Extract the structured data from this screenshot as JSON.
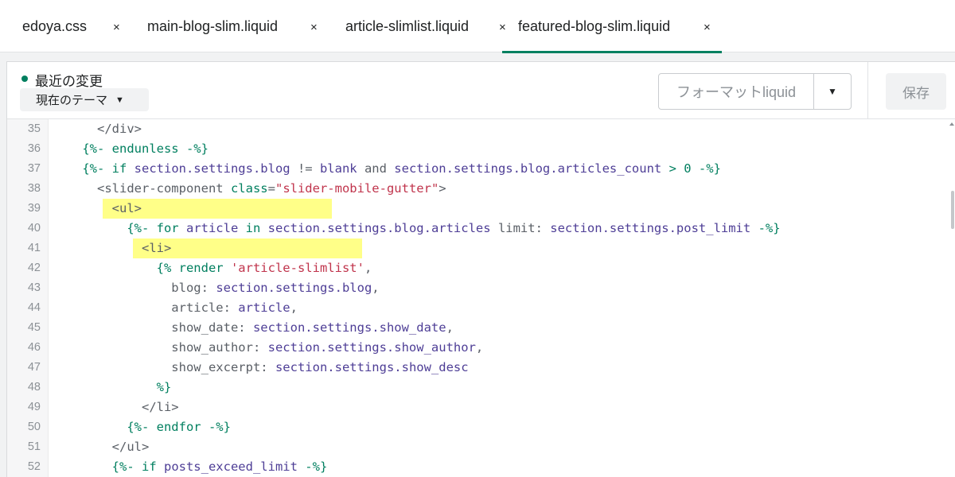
{
  "tabs": [
    {
      "label": "edoya.css",
      "close": "×",
      "active": false
    },
    {
      "label": "main-blog-slim.liquid",
      "close": "×",
      "active": false
    },
    {
      "label": "article-slimlist.liquid",
      "close": "×",
      "active": false
    },
    {
      "label": "featured-blog-slim.liquid",
      "close": "×",
      "active": true
    }
  ],
  "header": {
    "status_label": "最近の変更",
    "version_select": "現在のテーマ",
    "format_button": "フォーマットliquid",
    "save_button": "保存"
  },
  "colors": {
    "accent": "#008060",
    "keyword": "#007f5f",
    "variable": "#4e3e96",
    "string": "#c0344c",
    "tag": "#5a5f66",
    "highlight": "#ffff88"
  },
  "code": {
    "highlighted_lines": [
      39,
      41
    ],
    "lines": [
      {
        "n": "35",
        "tokens": [
          {
            "t": "      </div>",
            "c": "tag"
          }
        ]
      },
      {
        "n": "36",
        "tokens": [
          {
            "t": "    {%- endunless -%}",
            "c": "kw"
          }
        ]
      },
      {
        "n": "37",
        "tokens": [
          {
            "t": "    {%- if ",
            "c": "kw"
          },
          {
            "t": "section.settings.blog",
            "c": "var"
          },
          {
            "t": " != ",
            "c": "tag"
          },
          {
            "t": "blank",
            "c": "var"
          },
          {
            "t": " and ",
            "c": "tag"
          },
          {
            "t": "section.settings.blog.articles_count",
            "c": "var"
          },
          {
            "t": " > 0 -%}",
            "c": "kw"
          }
        ]
      },
      {
        "n": "38",
        "tokens": [
          {
            "t": "      <slider-component ",
            "c": "tag"
          },
          {
            "t": "class",
            "c": "kw"
          },
          {
            "t": "=",
            "c": "tag"
          },
          {
            "t": "\"slider-mobile-gutter\"",
            "c": "str"
          },
          {
            "t": ">",
            "c": "tag"
          }
        ]
      },
      {
        "n": "39",
        "tokens": [
          {
            "t": "        <ul>",
            "c": "tag"
          }
        ]
      },
      {
        "n": "40",
        "tokens": [
          {
            "t": "          {%- for ",
            "c": "kw"
          },
          {
            "t": "article",
            "c": "var"
          },
          {
            "t": " in ",
            "c": "kw"
          },
          {
            "t": "section.settings.blog.articles",
            "c": "var"
          },
          {
            "t": " limit: ",
            "c": "tag"
          },
          {
            "t": "section.settings.post_limit",
            "c": "var"
          },
          {
            "t": " -%}",
            "c": "kw"
          }
        ]
      },
      {
        "n": "41",
        "tokens": [
          {
            "t": "            <li>",
            "c": "tag"
          }
        ]
      },
      {
        "n": "42",
        "tokens": [
          {
            "t": "              {% render ",
            "c": "kw"
          },
          {
            "t": "'article-slimlist'",
            "c": "str"
          },
          {
            "t": ",",
            "c": "tag"
          }
        ]
      },
      {
        "n": "43",
        "tokens": [
          {
            "t": "                blog: ",
            "c": "tag"
          },
          {
            "t": "section.settings.blog",
            "c": "var"
          },
          {
            "t": ",",
            "c": "tag"
          }
        ]
      },
      {
        "n": "44",
        "tokens": [
          {
            "t": "                article: ",
            "c": "tag"
          },
          {
            "t": "article",
            "c": "var"
          },
          {
            "t": ",",
            "c": "tag"
          }
        ]
      },
      {
        "n": "45",
        "tokens": [
          {
            "t": "                show_date: ",
            "c": "tag"
          },
          {
            "t": "section.settings.show_date",
            "c": "var"
          },
          {
            "t": ",",
            "c": "tag"
          }
        ]
      },
      {
        "n": "46",
        "tokens": [
          {
            "t": "                show_author: ",
            "c": "tag"
          },
          {
            "t": "section.settings.show_author",
            "c": "var"
          },
          {
            "t": ",",
            "c": "tag"
          }
        ]
      },
      {
        "n": "47",
        "tokens": [
          {
            "t": "                show_excerpt: ",
            "c": "tag"
          },
          {
            "t": "section.settings.show_desc",
            "c": "var"
          }
        ]
      },
      {
        "n": "48",
        "tokens": [
          {
            "t": "              %}",
            "c": "kw"
          }
        ]
      },
      {
        "n": "49",
        "tokens": [
          {
            "t": "            </li>",
            "c": "tag"
          }
        ]
      },
      {
        "n": "50",
        "tokens": [
          {
            "t": "          {%- endfor -%}",
            "c": "kw"
          }
        ]
      },
      {
        "n": "51",
        "tokens": [
          {
            "t": "        </ul>",
            "c": "tag"
          }
        ]
      },
      {
        "n": "52",
        "tokens": [
          {
            "t": "        {%- if ",
            "c": "kw"
          },
          {
            "t": "posts_exceed_limit",
            "c": "var"
          },
          {
            "t": " -%}",
            "c": "kw"
          }
        ]
      }
    ]
  }
}
